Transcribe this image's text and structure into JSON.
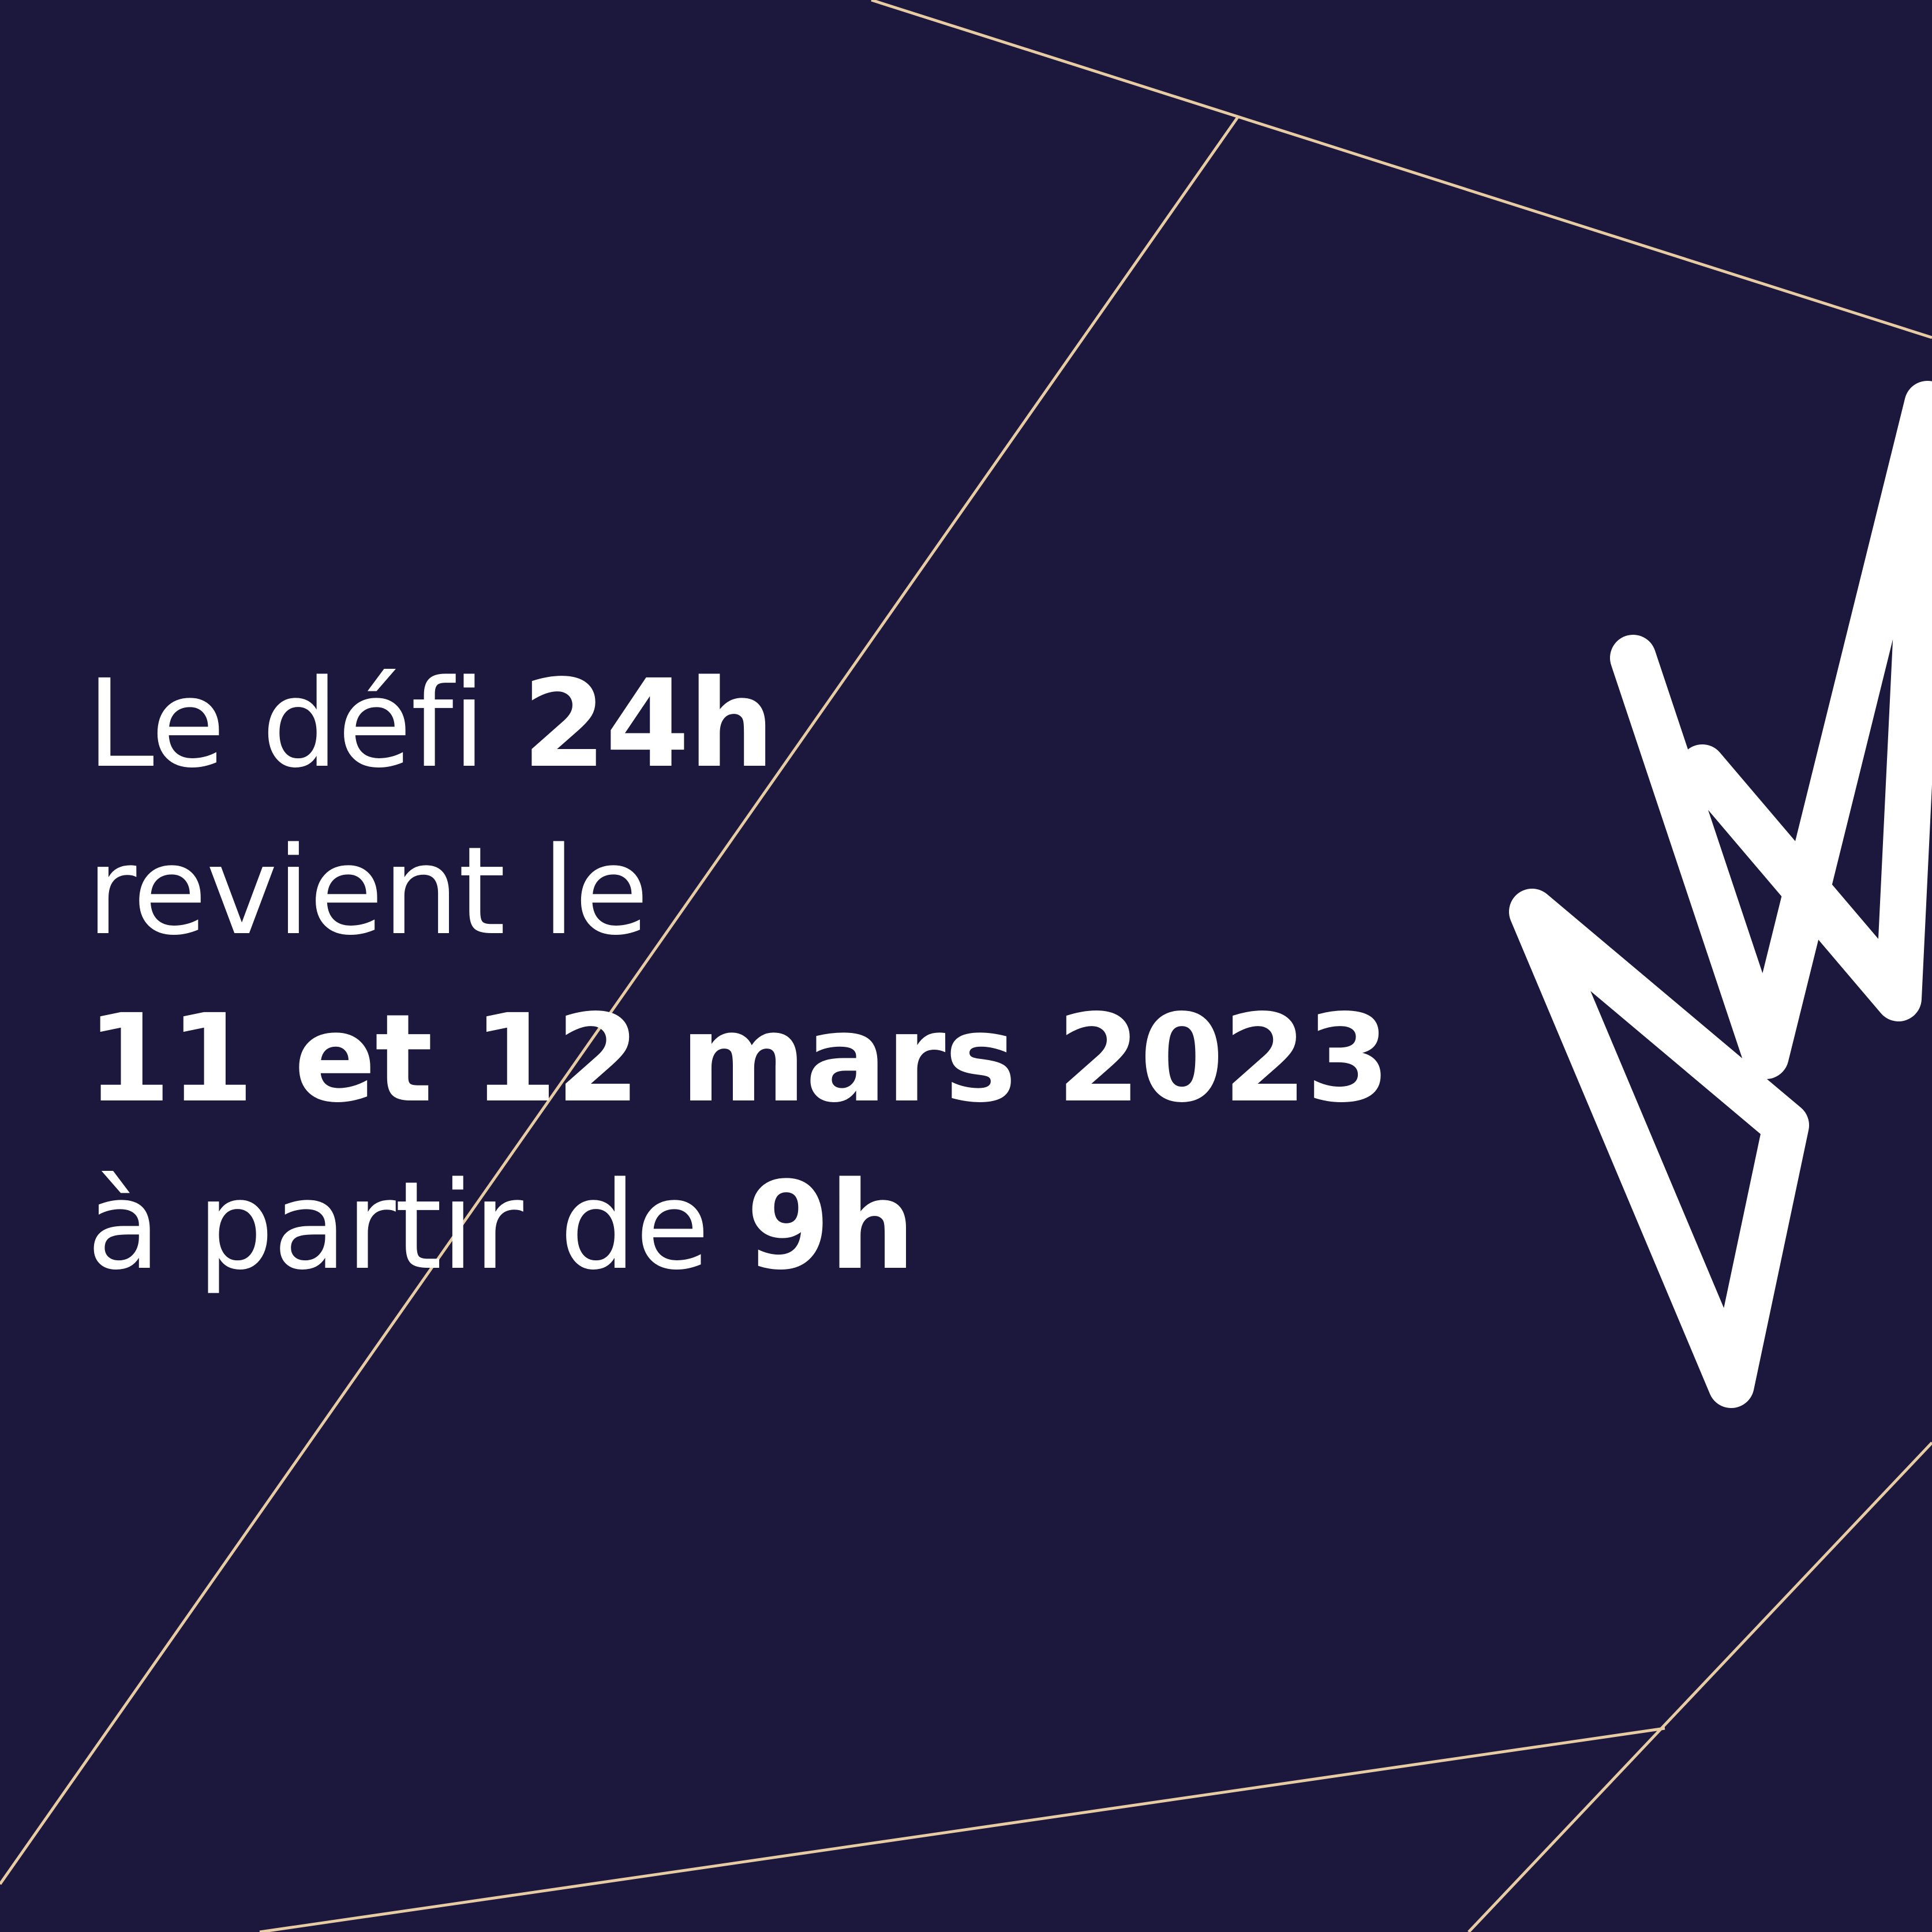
{
  "headline": {
    "line1_regular": "Le défi ",
    "line1_bold": "24h",
    "line2": "revient le",
    "line3_bold": "11 et 12 mars 2023",
    "line4_regular": "à partir de ",
    "line4_bold": "9h"
  },
  "colors": {
    "background": "#1c173c",
    "text": "#ffffff",
    "accent_lines": "#e6cba3",
    "logo": "#ffffff"
  },
  "icons": {
    "logo": "zigzag-crown-logo"
  }
}
